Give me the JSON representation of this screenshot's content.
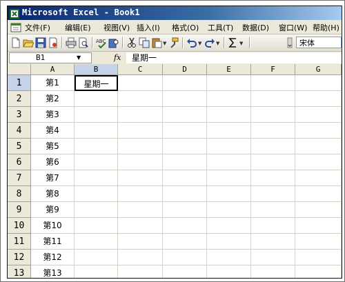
{
  "app": {
    "title": "Microsoft Excel - Book1"
  },
  "menu": {
    "items": [
      {
        "label": "文件(F)"
      },
      {
        "label": "编辑(E)"
      },
      {
        "label": "视图(V)"
      },
      {
        "label": "插入(I)"
      },
      {
        "label": "格式(O)"
      },
      {
        "label": "工具(T)"
      },
      {
        "label": "数据(D)"
      },
      {
        "label": "窗口(W)"
      },
      {
        "label": "帮助(H)"
      }
    ]
  },
  "toolbar": {
    "icons": [
      "new-icon",
      "open-icon",
      "save-icon",
      "permission-icon",
      "print-icon",
      "print-preview-icon",
      "spelling-icon",
      "research-icon",
      "cut-icon",
      "copy-icon",
      "paste-icon",
      "format-painter-icon",
      "undo-icon",
      "redo-icon",
      "autosum-icon"
    ],
    "font_name": "宋体"
  },
  "formula_bar": {
    "name_box": "B1",
    "fx_label": "fx",
    "value": "星期一"
  },
  "sheet": {
    "columns": [
      "A",
      "B",
      "C",
      "D",
      "E",
      "F",
      "G"
    ],
    "selected_column": "B",
    "selected_row": 1,
    "rows": [
      {
        "num": "1",
        "a": "第1",
        "b": "星期一"
      },
      {
        "num": "2",
        "a": "第2",
        "b": ""
      },
      {
        "num": "3",
        "a": "第3",
        "b": ""
      },
      {
        "num": "4",
        "a": "第4",
        "b": ""
      },
      {
        "num": "5",
        "a": "第5",
        "b": ""
      },
      {
        "num": "6",
        "a": "第6",
        "b": ""
      },
      {
        "num": "7",
        "a": "第7",
        "b": ""
      },
      {
        "num": "8",
        "a": "第8",
        "b": ""
      },
      {
        "num": "9",
        "a": "第9",
        "b": ""
      },
      {
        "num": "10",
        "a": "第10",
        "b": ""
      },
      {
        "num": "11",
        "a": "第11",
        "b": ""
      },
      {
        "num": "12",
        "a": "第12",
        "b": ""
      },
      {
        "num": "13",
        "a": "第13",
        "b": ""
      }
    ]
  },
  "colors": {
    "titlebar_start": "#0a246a",
    "titlebar_end": "#a6caf0",
    "chrome": "#ece9d8",
    "header_selected": "#c6d3e8",
    "gridline": "#d4d0c8"
  }
}
